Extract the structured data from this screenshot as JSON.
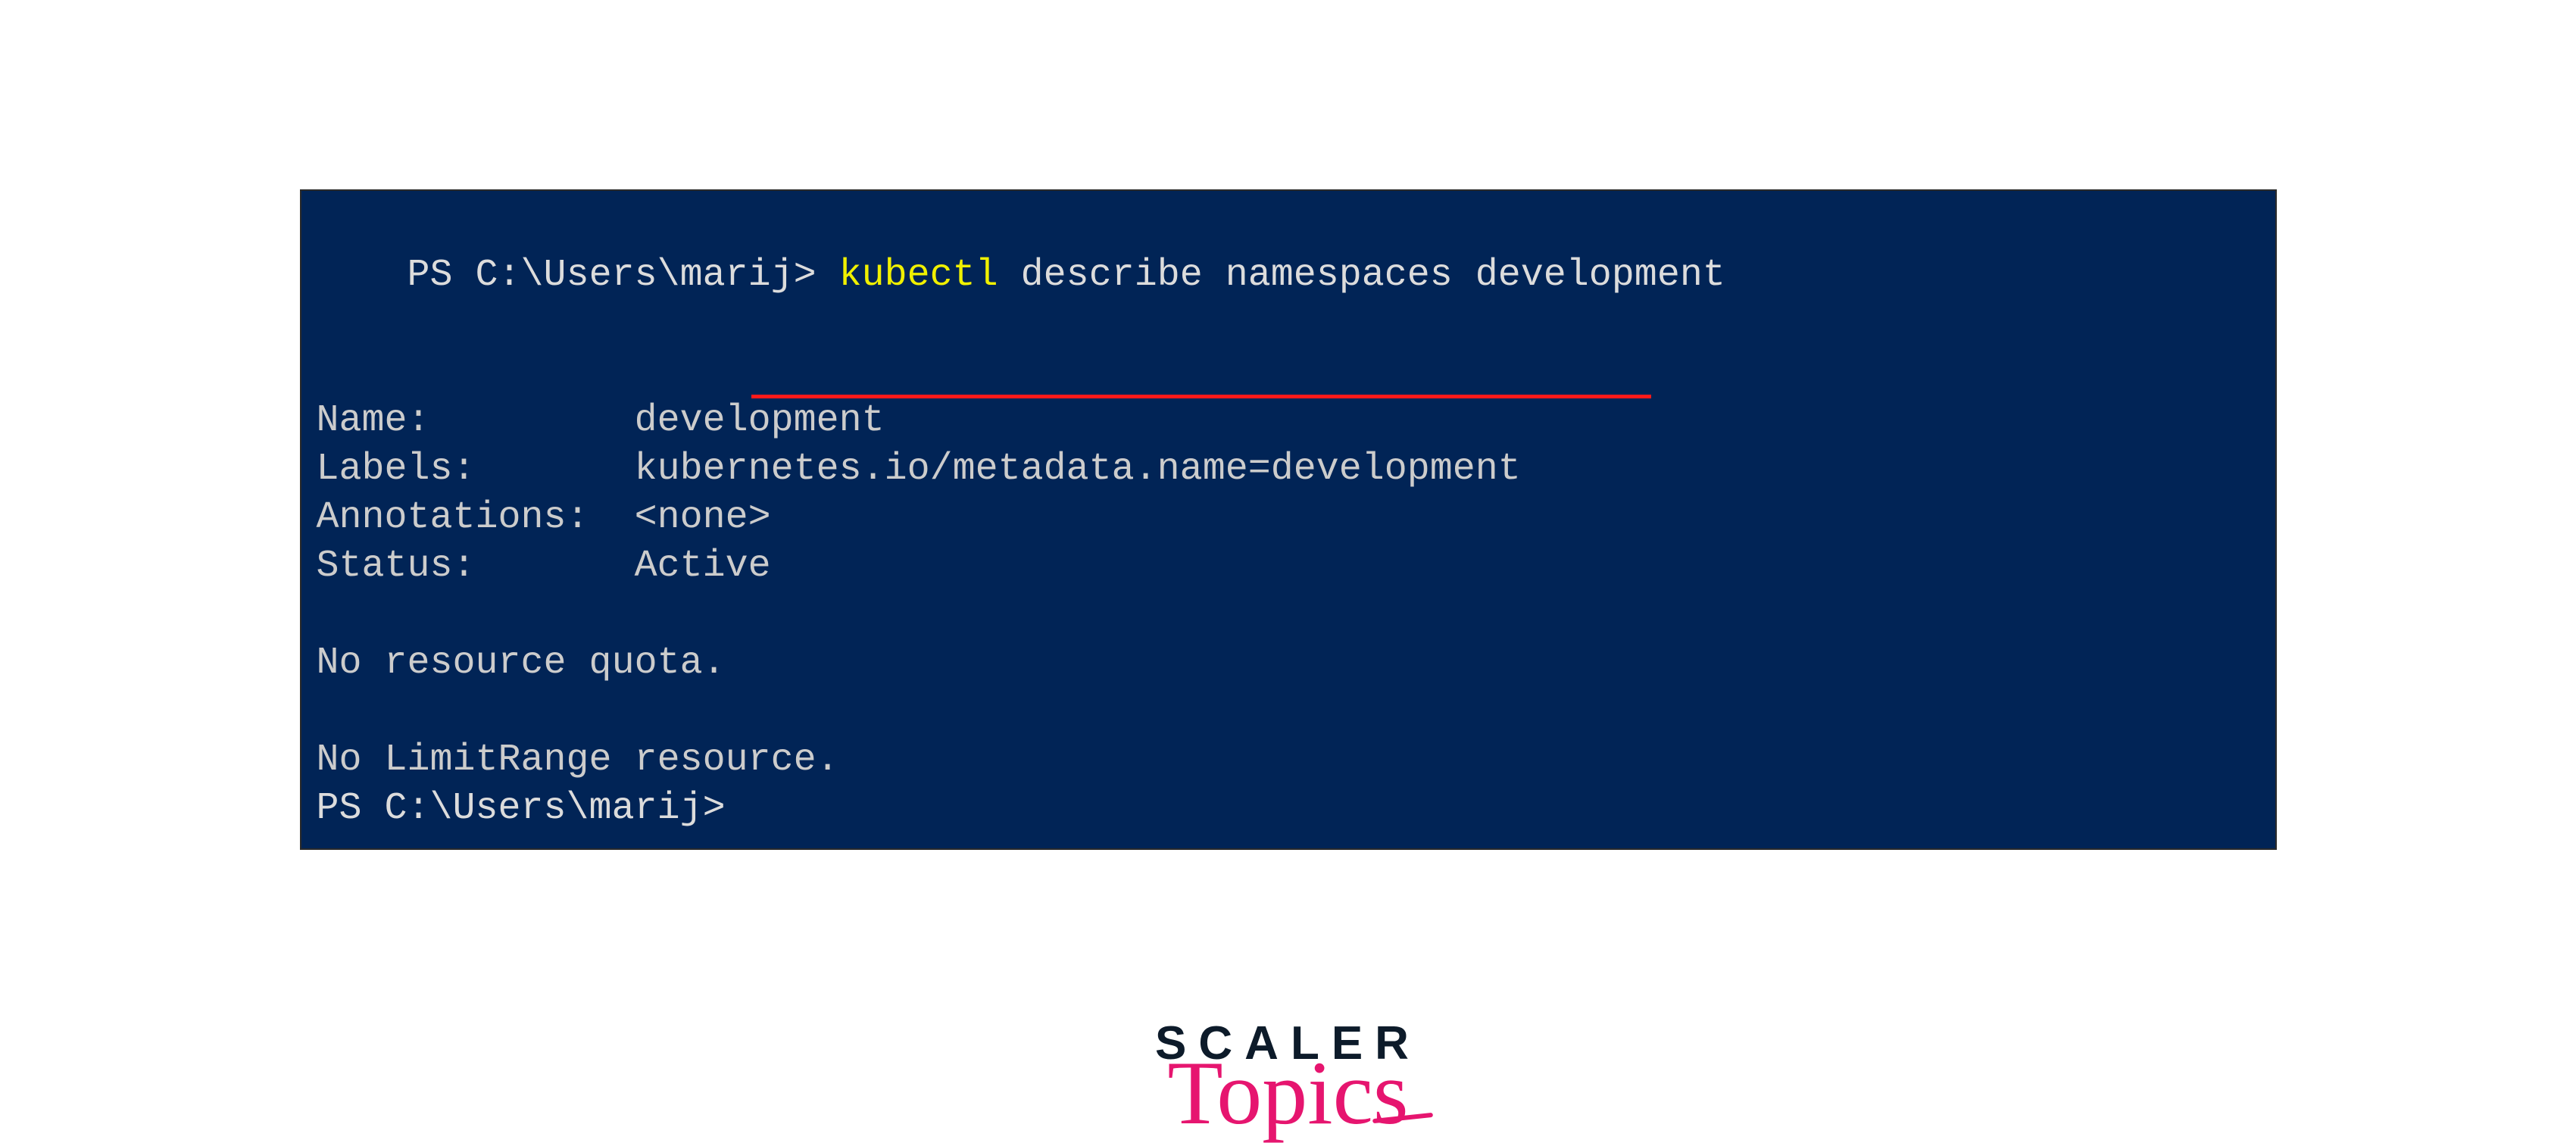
{
  "terminal": {
    "prompt1_prefix": "PS C:\\Users\\marij> ",
    "cmd_kubectl": "kubectl",
    "cmd_rest": " describe namespaces development",
    "out_name": "Name:         development",
    "out_labels": "Labels:       kubernetes.io/metadata.name=development",
    "out_annotations": "Annotations:  <none>",
    "out_status": "Status:       Active",
    "out_noquota": "No resource quota.",
    "out_nolimit": "No LimitRange resource.",
    "prompt2": "PS C:\\Users\\marij>"
  },
  "logo": {
    "line1": "SCALER",
    "line2": "Topics"
  }
}
